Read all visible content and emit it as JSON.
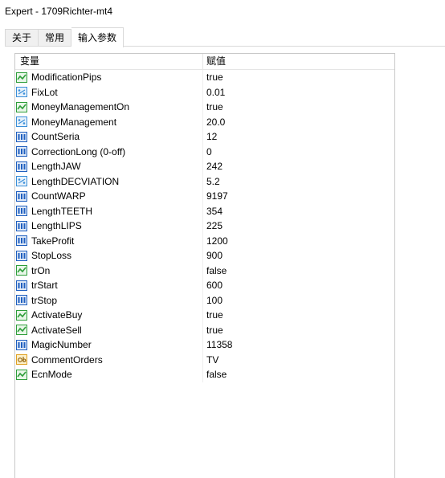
{
  "window": {
    "title": "Expert - 1709Richter-mt4"
  },
  "tabs": [
    {
      "label": "关于",
      "active": false
    },
    {
      "label": "常用",
      "active": false
    },
    {
      "label": "输入参数",
      "active": true
    }
  ],
  "grid": {
    "headers": {
      "variable": "变量",
      "value": "赋值"
    },
    "rows": [
      {
        "name": "ModificationPips",
        "value": "true",
        "icon": "bool-icon"
      },
      {
        "name": "FixLot",
        "value": "0.01",
        "icon": "double-icon"
      },
      {
        "name": "MoneyManagementOn",
        "value": "true",
        "icon": "bool-icon"
      },
      {
        "name": "MoneyManagement",
        "value": "20.0",
        "icon": "double-icon"
      },
      {
        "name": "CountSeria",
        "value": "12",
        "icon": "int-icon"
      },
      {
        "name": "CorrectionLong (0-off)",
        "value": "0",
        "icon": "int-icon"
      },
      {
        "name": "LengthJAW",
        "value": "242",
        "icon": "int-icon"
      },
      {
        "name": "LengthDECVIATION",
        "value": "5.2",
        "icon": "double-icon"
      },
      {
        "name": "CountWARP",
        "value": "9197",
        "icon": "int-icon"
      },
      {
        "name": "LengthTEETH",
        "value": "354",
        "icon": "int-icon"
      },
      {
        "name": "LengthLIPS",
        "value": "225",
        "icon": "int-icon"
      },
      {
        "name": "TakeProfit",
        "value": "1200",
        "icon": "int-icon"
      },
      {
        "name": "StopLoss",
        "value": "900",
        "icon": "int-icon"
      },
      {
        "name": "trOn",
        "value": "false",
        "icon": "bool-icon"
      },
      {
        "name": "trStart",
        "value": "600",
        "icon": "int-icon"
      },
      {
        "name": "trStop",
        "value": "100",
        "icon": "int-icon"
      },
      {
        "name": "ActivateBuy",
        "value": "true",
        "icon": "bool-icon"
      },
      {
        "name": "ActivateSell",
        "value": "true",
        "icon": "bool-icon"
      },
      {
        "name": "MagicNumber",
        "value": "11358",
        "icon": "int-icon"
      },
      {
        "name": "CommentOrders",
        "value": "TV",
        "icon": "string-icon"
      },
      {
        "name": "EcnMode",
        "value": "false",
        "icon": "bool-icon"
      }
    ]
  },
  "colors": {
    "bool_icon": "#2e9e3a",
    "double_icon": "#3a8fd9",
    "int_icon": "#1f5fbf",
    "string_icon": "#e0a020"
  }
}
